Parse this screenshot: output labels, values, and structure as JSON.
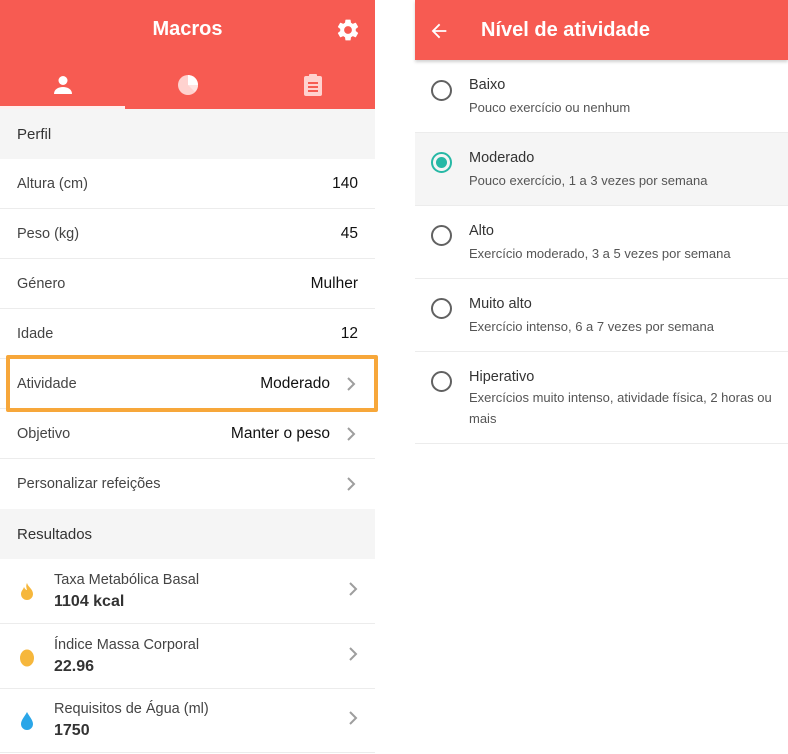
{
  "left_screen": {
    "app_title": "Macros",
    "sections": {
      "profile": "Perfil",
      "results": "Resultados"
    },
    "profile_rows": [
      {
        "label": "Altura (cm)",
        "value": "140"
      },
      {
        "label": "Peso (kg)",
        "value": "45"
      },
      {
        "label": "Género",
        "value": "Mulher"
      },
      {
        "label": "Idade",
        "value": "12"
      },
      {
        "label": "Atividade",
        "value": "Moderado"
      },
      {
        "label": "Objetivo",
        "value": "Manter o peso"
      },
      {
        "label": "Personalizar refeições",
        "value": ""
      }
    ],
    "results": [
      {
        "label": "Taxa Metabólica Basal",
        "value": "1104 kcal",
        "icon": "flame-icon",
        "color": "#f6b73c"
      },
      {
        "label": "Índice Massa Corporal",
        "value": "22.96",
        "icon": "egg-icon",
        "color": "#f6b73c"
      },
      {
        "label": "Requisitos de Água (ml)",
        "value": "1750",
        "icon": "water-drop-icon",
        "color": "#2aa6e8"
      }
    ],
    "tabs": [
      {
        "icon": "person-icon",
        "active": true
      },
      {
        "icon": "pie-chart-icon",
        "active": false
      },
      {
        "icon": "clipboard-icon",
        "active": false
      }
    ]
  },
  "right_screen": {
    "title": "Nível de atividade",
    "options": [
      {
        "title": "Baixo",
        "desc": "Pouco exercício ou nenhum",
        "selected": false
      },
      {
        "title": "Moderado",
        "desc": "Pouco exercício, 1 a 3 vezes por semana",
        "selected": true
      },
      {
        "title": "Alto",
        "desc": "Exercício moderado, 3 a 5 vezes por semana",
        "selected": false
      },
      {
        "title": "Muito alto",
        "desc": "Exercício intenso, 6 a 7 vezes por semana",
        "selected": false
      },
      {
        "title": "Hiperativo",
        "desc": "Exercícios muito intenso, atividade física, 2 horas ou mais",
        "selected": false
      }
    ]
  },
  "colors": {
    "primary": "#f75b52",
    "accent": "#26b8a5",
    "highlight": "#f7a73a"
  }
}
